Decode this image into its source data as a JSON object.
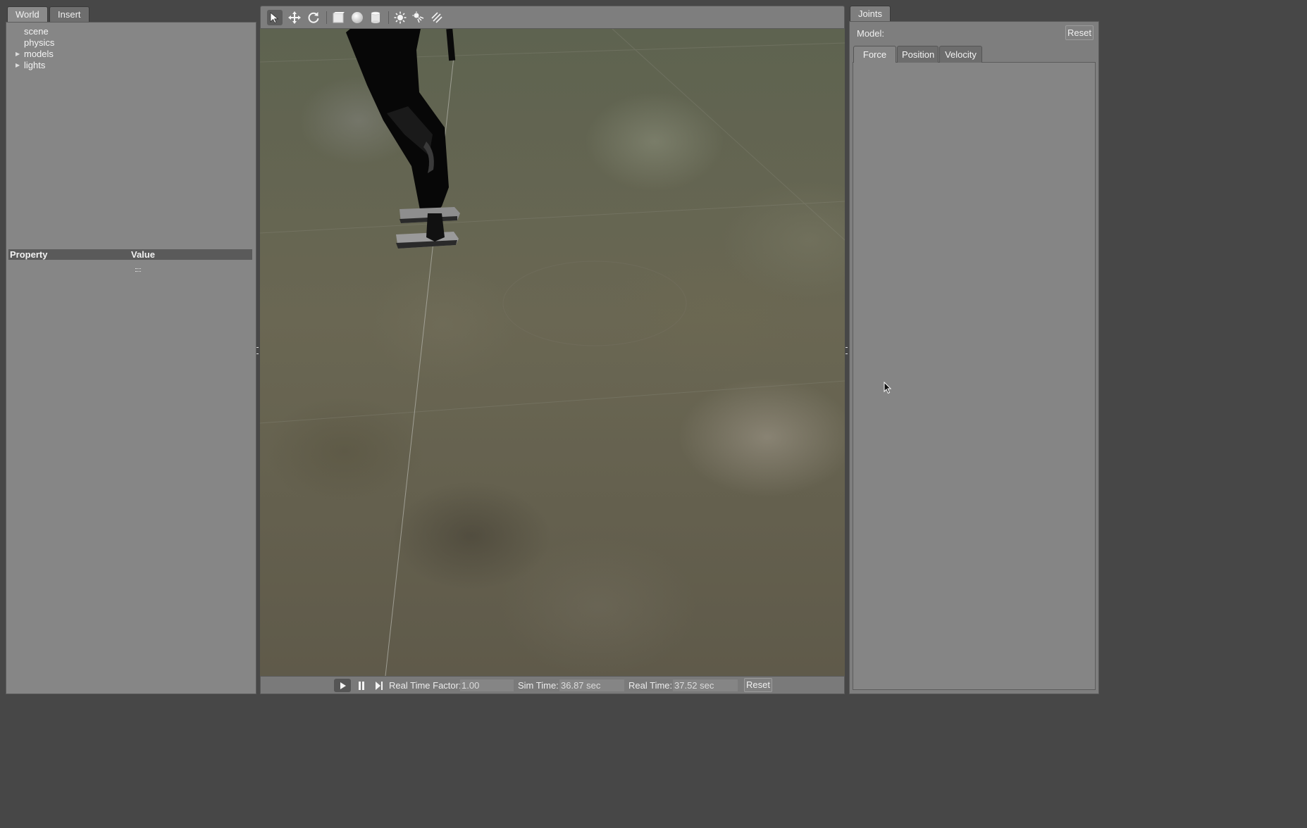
{
  "left_tabs": [
    {
      "label": "World"
    },
    {
      "label": "Insert"
    }
  ],
  "tree": [
    {
      "label": "scene",
      "expandable": false
    },
    {
      "label": "physics",
      "expandable": false
    },
    {
      "label": "models",
      "expandable": true
    },
    {
      "label": "lights",
      "expandable": true
    }
  ],
  "property_table": {
    "property": "Property",
    "value": "Value"
  },
  "toolbar": {
    "tools": [
      "select-icon",
      "translate-icon",
      "rotate-icon",
      "box-icon",
      "sphere-icon",
      "cylinder-icon",
      "point-light-icon",
      "spot-light-icon",
      "directional-light-icon"
    ],
    "active_tool": "select-icon"
  },
  "bottom_bar": {
    "real_time_factor_label": "Real Time Factor:",
    "real_time_factor": "1.00",
    "sim_time_label": "Sim Time:",
    "sim_time": "36.87 sec",
    "real_time_label": "Real Time:",
    "real_time": "37.52 sec",
    "reset_label": "Reset"
  },
  "right_panel": {
    "tab": "Joints",
    "model_label": "Model:",
    "reset_label": "Reset",
    "subtabs": [
      {
        "label": "Force"
      },
      {
        "label": "Position"
      },
      {
        "label": "Velocity"
      }
    ],
    "active_subtab": "Force"
  },
  "colors": {
    "background": "#474747",
    "panel": "#868686",
    "ground_texture": "#636050"
  }
}
